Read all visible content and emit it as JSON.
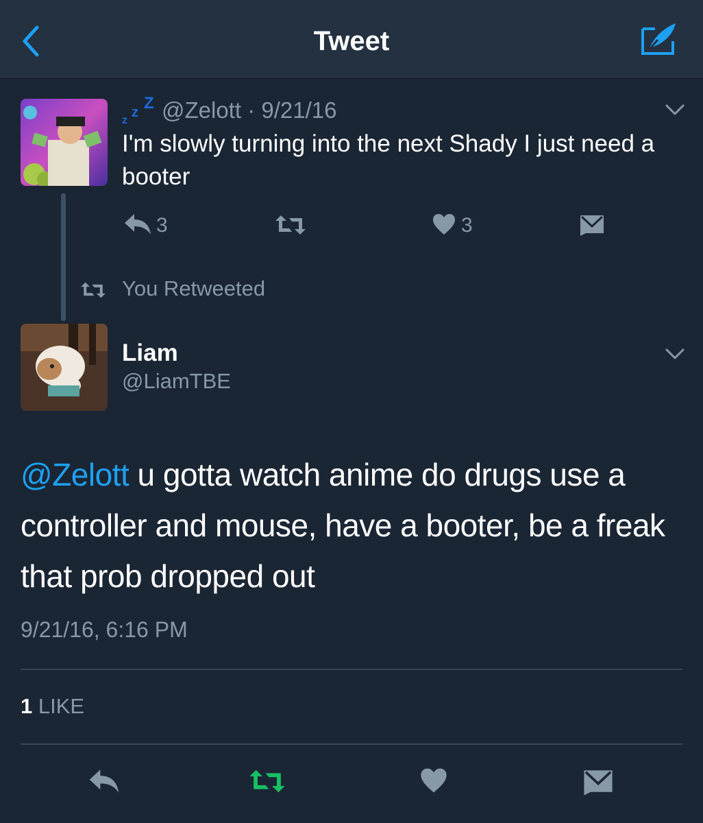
{
  "header": {
    "title": "Tweet"
  },
  "reply_tweet": {
    "handle": "@Zelott",
    "separator": "·",
    "date": "9/21/16",
    "text": "I'm slowly turning into the next Shady I just need a booter",
    "reply_count": "3",
    "like_count": "3"
  },
  "retweet_notice": {
    "text": "You Retweeted"
  },
  "main_tweet": {
    "author_name": "Liam",
    "author_handle": "@LiamTBE",
    "mention": "@Zelott",
    "text": " u gotta watch anime do drugs use a controller and mouse, have a booter, be a freak that prob dropped out",
    "timestamp": "9/21/16, 6:16 PM",
    "like_count": "1",
    "like_label": "LIKE"
  },
  "colors": {
    "background": "#1b2634",
    "navbar": "#243141",
    "accent_blue": "#1da1f2",
    "retweet_green": "#17bf63",
    "muted": "#8899a6"
  },
  "icons": {
    "back": "chevron-left-icon",
    "compose": "compose-icon",
    "sleep": "zzz-icon",
    "reply": "reply-icon",
    "retweet": "retweet-icon",
    "like": "heart-icon",
    "message": "envelope-icon",
    "menu": "chevron-down-icon"
  }
}
